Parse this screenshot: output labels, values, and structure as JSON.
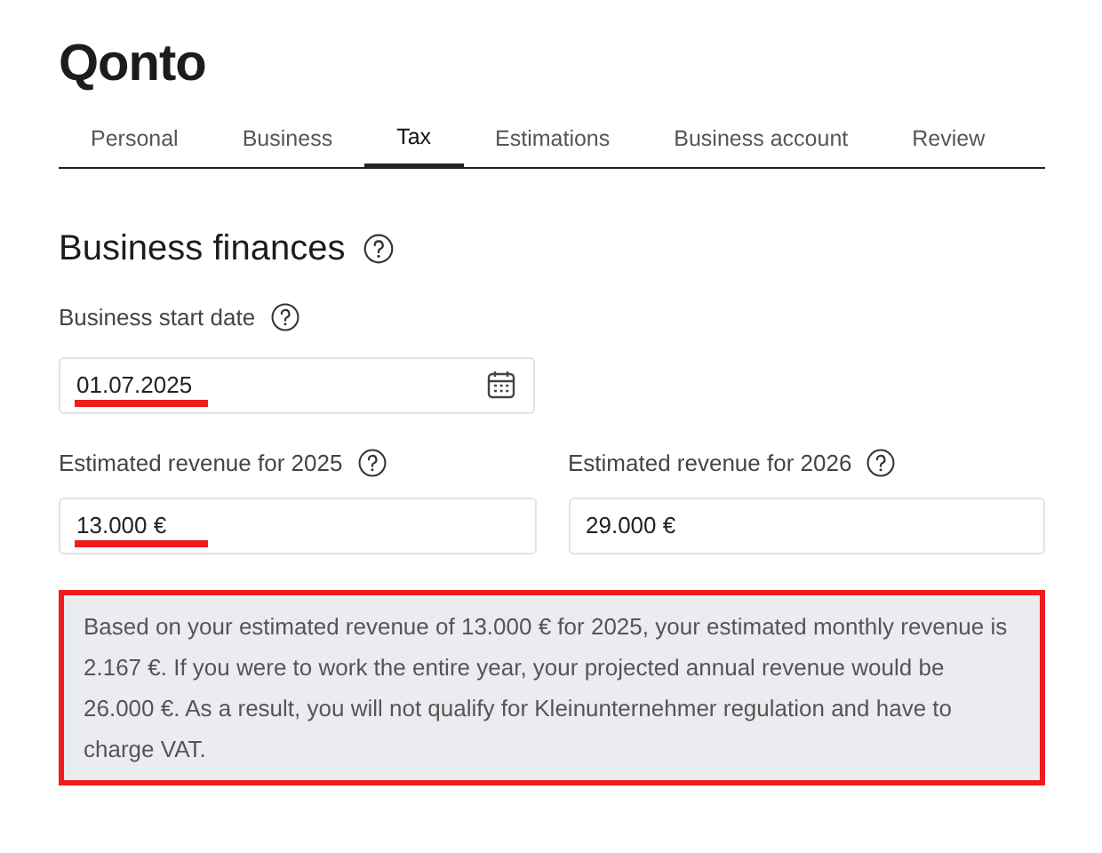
{
  "logo": "Qonto",
  "tabs": [
    {
      "label": "Personal",
      "selected": false
    },
    {
      "label": "Business",
      "selected": false
    },
    {
      "label": "Tax",
      "selected": true
    },
    {
      "label": "Estimations",
      "selected": false
    },
    {
      "label": "Business account",
      "selected": false
    },
    {
      "label": "Review",
      "selected": false
    }
  ],
  "section": {
    "title": "Business finances"
  },
  "start_date": {
    "label": "Business start date",
    "value": "01.07.2025",
    "highlighted": true
  },
  "revenue_fields": [
    {
      "label": "Estimated revenue for 2025",
      "value": "13.000 €",
      "highlighted": true
    },
    {
      "label": "Estimated revenue for 2026",
      "value": "29.000 €",
      "highlighted": false
    }
  ],
  "info": {
    "text": "Based on your estimated revenue of 13.000 € for 2025, your estimated monthly revenue is 2.167 €. If you were to work the entire year, your projected annual revenue would be 26.000 €. As a result, you will not qualify for Kleinunternehmer regulation and have to charge VAT.",
    "highlighted": true
  }
}
